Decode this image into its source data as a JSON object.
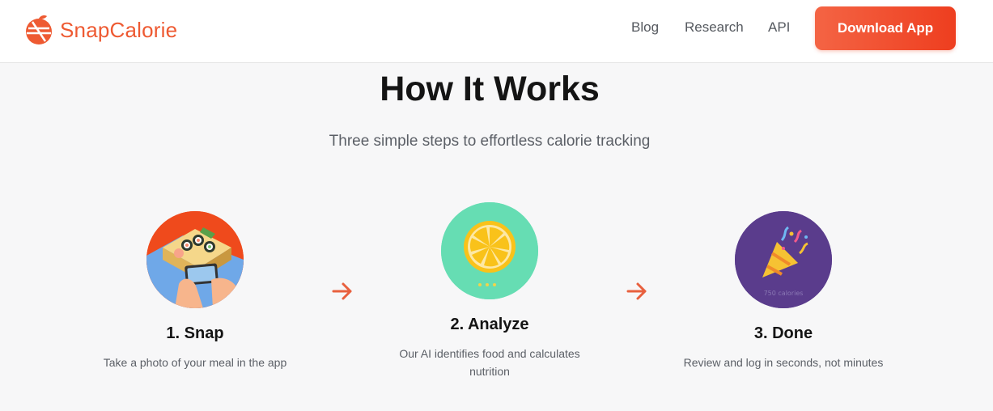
{
  "header": {
    "brand_name": "SnapCalorie",
    "nav": [
      "Blog",
      "Research",
      "API"
    ],
    "download_label": "Download App"
  },
  "section": {
    "title": "How It Works",
    "subtitle": "Three simple steps to effortless calorie tracking"
  },
  "steps": [
    {
      "title": "1. Snap",
      "description": "Take a photo of your meal in the app",
      "icon": "sushi-photo-icon",
      "color": "#ef4a1c"
    },
    {
      "title": "2. Analyze",
      "description": "Our AI identifies food and calculates nutrition",
      "icon": "lemon-slice-icon",
      "color": "#66ddb3"
    },
    {
      "title": "3. Done",
      "description": "Review and log in seconds, not minutes",
      "icon": "party-popper-icon",
      "color": "#5a3c8c",
      "badge": "750 calories"
    }
  ],
  "colors": {
    "accent": "#ee5a32",
    "arrow": "#e8603e"
  }
}
